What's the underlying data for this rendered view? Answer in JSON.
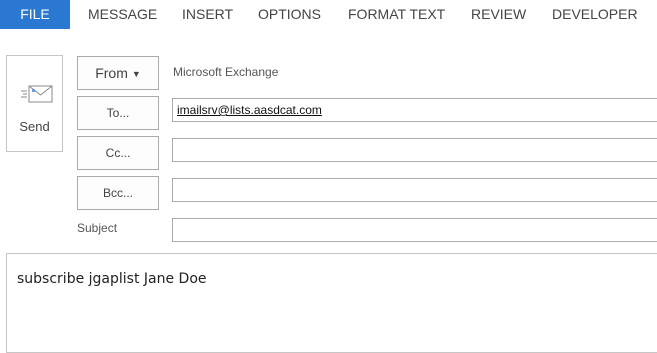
{
  "ribbon": {
    "tabs": [
      {
        "label": "FILE"
      },
      {
        "label": "MESSAGE"
      },
      {
        "label": "INSERT"
      },
      {
        "label": "OPTIONS"
      },
      {
        "label": "FORMAT TEXT"
      },
      {
        "label": "REVIEW"
      },
      {
        "label": "DEVELOPER"
      }
    ],
    "active_tab_color": "#2b78d2"
  },
  "send": {
    "label": "Send",
    "icon": "send-envelope-icon"
  },
  "from": {
    "button_label": "From",
    "caret_icon": "caret-down-icon",
    "account": "Microsoft Exchange"
  },
  "to": {
    "button_label": "To...",
    "recipients": [
      "imailsrv@lists.aasdcat.com"
    ]
  },
  "cc": {
    "button_label": "Cc...",
    "value": ""
  },
  "bcc": {
    "button_label": "Bcc...",
    "value": ""
  },
  "subject": {
    "label": "Subject",
    "value": ""
  },
  "message": {
    "body": "subscribe jgaplist Jane Doe"
  }
}
